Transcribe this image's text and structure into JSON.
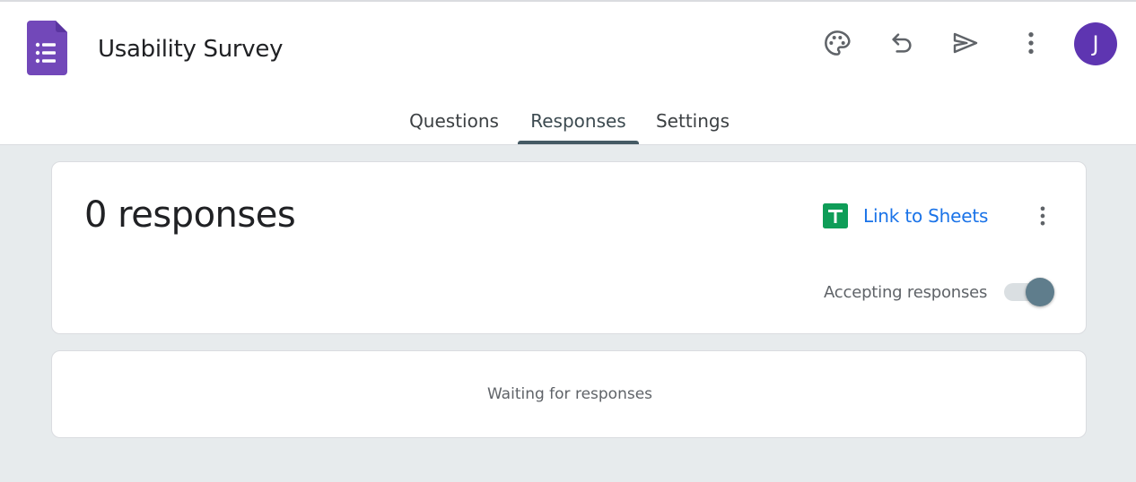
{
  "app": {
    "title": "Usability Survey",
    "logo_icon": "google-forms-icon",
    "brand_color": "#7248b9"
  },
  "toolbar": {
    "icons": [
      "palette-icon",
      "undo-icon",
      "send-icon",
      "more-vert-icon"
    ],
    "avatar_letter": "J",
    "avatar_color": "#5e35b1"
  },
  "tabs": [
    {
      "label": "Questions",
      "active": false
    },
    {
      "label": "Responses",
      "active": true
    },
    {
      "label": "Settings",
      "active": false
    }
  ],
  "responses": {
    "count_label": "0 responses",
    "link_label": "Link to Sheets",
    "link_icon": "google-sheets-icon",
    "link_color": "#1a73e8",
    "sheets_color": "#0f9d58",
    "accepting_label": "Accepting responses",
    "accepting_enabled": true,
    "waiting_text": "Waiting for responses"
  }
}
